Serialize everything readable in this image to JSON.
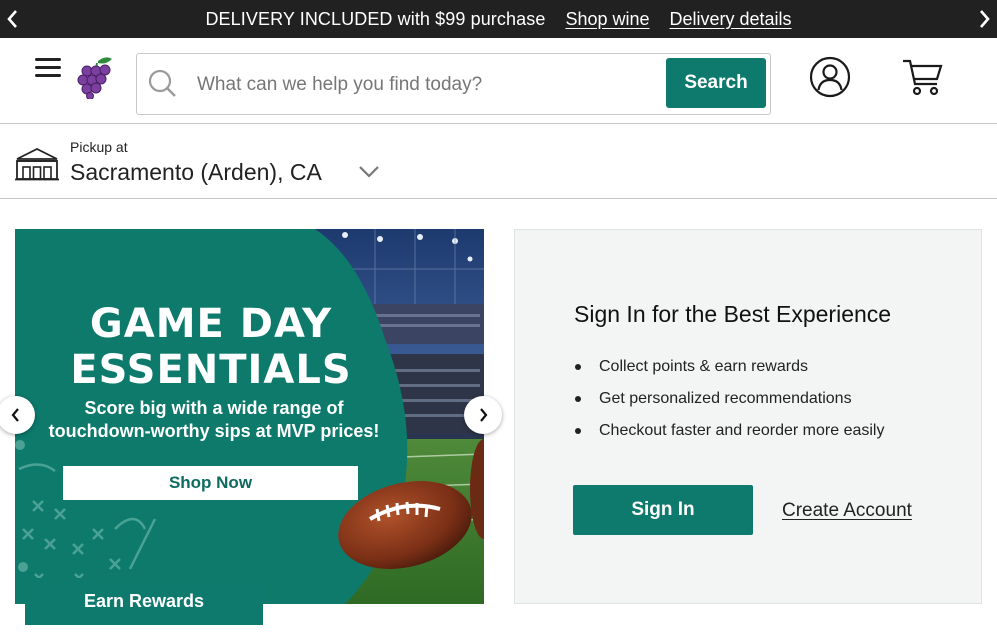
{
  "promo_bar": {
    "message": "DELIVERY INCLUDED with $99 purchase",
    "links": [
      "Shop wine",
      "Delivery details"
    ],
    "prev_icon": "chevron-left-icon",
    "next_icon": "chevron-right-icon"
  },
  "header": {
    "menu_icon": "hamburger-menu-icon",
    "logo_icon": "grape-logo-icon",
    "search": {
      "placeholder": "What can we help you find today?",
      "value": "",
      "button_label": "Search",
      "icon": "search-icon"
    },
    "account_icon": "user-account-icon",
    "cart_icon": "shopping-cart-icon"
  },
  "store": {
    "pickup_label": "Pickup at",
    "store_name": "Sacramento (Arden), CA",
    "icon": "store-building-icon"
  },
  "hero": {
    "title_line1": "GAME DAY",
    "title_line2": "ESSENTIALS",
    "subtitle_line1": "Score big with a wide range of",
    "subtitle_line2": "touchdown-worthy sips at MVP prices!",
    "cta_label": "Shop Now",
    "earn_label": "Earn Rewards"
  },
  "signin_panel": {
    "heading": "Sign In for the Best Experience",
    "benefits": [
      "Collect points & earn rewards",
      "Get personalized recommendations",
      "Checkout faster and reorder more easily"
    ],
    "signin_label": "Sign In",
    "create_label": "Create Account"
  },
  "colors": {
    "brand_green": "#0e7a6d",
    "promo_bg": "#212121",
    "panel_bg": "#f3f5f5"
  }
}
